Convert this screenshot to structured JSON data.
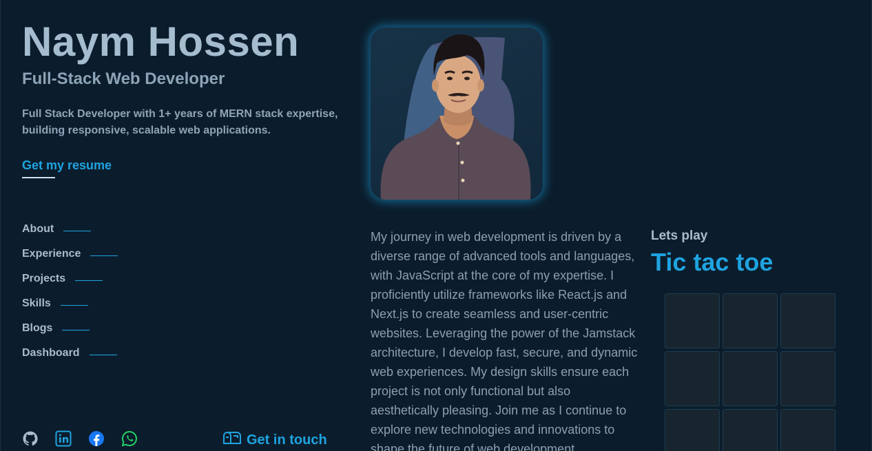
{
  "hero": {
    "name": "Naym Hossen",
    "role": "Full-Stack Web Developer",
    "summary": "Full Stack Developer with 1+ years of MERN stack expertise, building responsive, scalable web applications.",
    "resume_label": "Get my resume"
  },
  "nav": {
    "items": [
      {
        "label": "About",
        "line_width": 40
      },
      {
        "label": "Experience",
        "line_width": 40
      },
      {
        "label": "Projects",
        "line_width": 40
      },
      {
        "label": "Skills",
        "line_width": 40
      },
      {
        "label": "Blogs",
        "line_width": 40
      },
      {
        "label": "Dashboard",
        "line_width": 40
      }
    ]
  },
  "social": {
    "icons": [
      "github-icon",
      "linkedin-icon",
      "facebook-icon",
      "whatsapp-icon"
    ]
  },
  "contact": {
    "label": "Get in touch",
    "icon": "mailbox-icon"
  },
  "about": {
    "journey": "My journey in web development is driven by a diverse range of advanced tools and languages, with JavaScript at the core of my expertise. I proficiently utilize frameworks like React.js and Next.js to create seamless and user-centric websites. Leveraging the power of the Jamstack architecture, I develop fast, secure, and dynamic web experiences. My design skills ensure each project is not only functional but also aesthetically pleasing. Join me as I continue to explore new technologies and innovations to shape the future of web development."
  },
  "game": {
    "subtitle": "Lets play",
    "title": "Tic tac toe",
    "cells": [
      "",
      "",
      "",
      "",
      "",
      "",
      "",
      "",
      ""
    ]
  },
  "colors": {
    "background": "#0b1d2c",
    "accent": "#1fa3e0",
    "text": "#9fb3c8",
    "cell": "#18252e"
  }
}
